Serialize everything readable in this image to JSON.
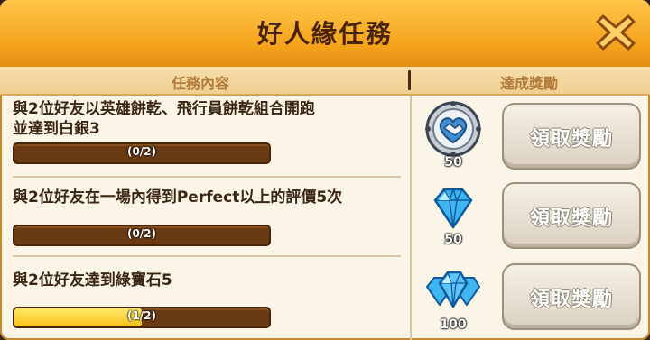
{
  "header": {
    "title": "好人緣任務"
  },
  "columns": {
    "mission": "任務內容",
    "reward": "達成獎勵"
  },
  "missions": [
    {
      "text_line1": "與2位好友以英雄餅乾、飛行員餅乾組合開跑",
      "text_line2": "並達到白銀3",
      "progress_label": "(0/2)",
      "progress": 0,
      "reward_icon": "friend-badge-icon",
      "reward_amount": "50",
      "claim_label": "領取獎勵"
    },
    {
      "text_line1": "與2位好友在一場內得到Perfect以上的評價5次",
      "text_line2": "",
      "progress_label": "(0/2)",
      "progress": 0,
      "reward_icon": "gem-icon",
      "reward_amount": "50",
      "claim_label": "領取獎勵"
    },
    {
      "text_line1": "與2位好友達到綠寶石5",
      "text_line2": "",
      "progress_label": "(1/2)",
      "progress": 0.5,
      "reward_icon": "gems-pile-icon",
      "reward_amount": "100",
      "claim_label": "領取獎勵"
    }
  ],
  "colors": {
    "header": "#f4a21b",
    "bar_fill": "#f7c21a",
    "bar_bg": "#6a3a12"
  }
}
